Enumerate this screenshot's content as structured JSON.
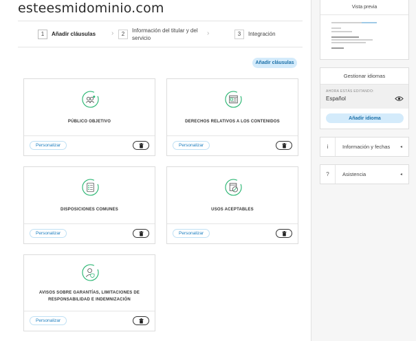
{
  "site": {
    "title": "esteesmidominio.com"
  },
  "stepper": {
    "steps": [
      {
        "num": "1",
        "label": "Añadir cláusulas"
      },
      {
        "num": "2",
        "label": "Información del titular y del servicio"
      },
      {
        "num": "3",
        "label": "Integración"
      }
    ]
  },
  "actions": {
    "add_clauses": "Añadir cláusulas"
  },
  "cards": [
    {
      "title": "PÚBLICO OBJETIVO",
      "icon": "target-audience-icon",
      "customize": "Personalizar"
    },
    {
      "title": "DERECHOS RELATIVOS A LOS CONTENIDOS",
      "icon": "content-rights-icon",
      "customize": "Personalizar"
    },
    {
      "title": "DISPOSICIONES COMUNES",
      "icon": "common-provisions-icon",
      "customize": "Personalizar"
    },
    {
      "title": "USOS ACEPTABLES",
      "icon": "acceptable-use-icon",
      "customize": "Personalizar"
    },
    {
      "title": "AVISOS SOBRE GARANTÍAS, LIMITACIONES DE RESPONSABILIDAD E INDEMNIZACIÓN",
      "icon": "warranty-notice-icon",
      "customize": "Personalizar"
    }
  ],
  "sidebar": {
    "preview": {
      "title": "Vista previa"
    },
    "languages": {
      "title": "Gestionar idiomas",
      "editing_label": "AHORA ESTÁS EDITANDO:",
      "editing_value": "Español",
      "add_button": "Añadir idioma"
    },
    "info": {
      "icon_text": "i",
      "label": "Información y fechas"
    },
    "help": {
      "icon_text": "?",
      "label": "Asistencia"
    }
  },
  "colors": {
    "accent": "#2bb673",
    "link": "#1a7dbf",
    "button_bg": "#d4ebfb"
  }
}
